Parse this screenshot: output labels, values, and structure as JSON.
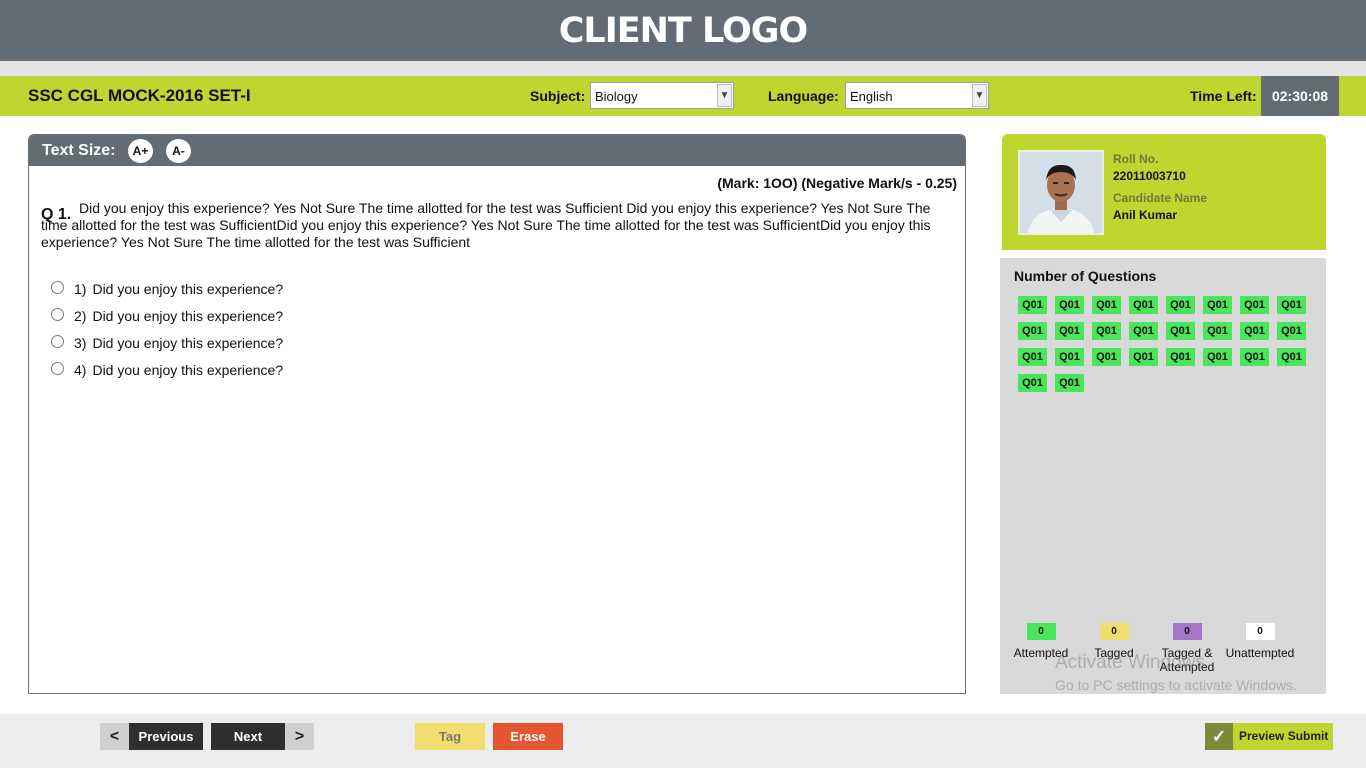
{
  "header": {
    "logo_text": "CLIENT LOGO"
  },
  "exam_bar": {
    "title": "SSC CGL MOCK-2016 SET-I",
    "subject_label": "Subject:",
    "subject_value": "Biology",
    "language_label": "Language:",
    "language_value": "English",
    "time_label": "Time Left:",
    "time_value": "02:30:08"
  },
  "question_panel": {
    "text_size_label": "Text Size:",
    "increase_label": "A+",
    "decrease_label": "A-",
    "marks": "(Mark: 1OO) (Negative Mark/s - 0.25)",
    "question_number": "Q 1.",
    "question_text": "Did you enjoy this experience? Yes Not Sure The time allotted for the test was Sufficient Did you enjoy this experience? Yes Not Sure The time allotted for the test was SufficientDid you enjoy this experience? Yes Not Sure The time allotted for the test was SufficientDid you enjoy this experience? Yes Not Sure The time allotted for the test was Sufficient",
    "options": [
      {
        "num": "1)",
        "text": "Did you enjoy this experience?"
      },
      {
        "num": "2)",
        "text": "Did you enjoy this experience?"
      },
      {
        "num": "3)",
        "text": "Did you enjoy this experience?"
      },
      {
        "num": "4)",
        "text": "Did you enjoy this experience?"
      }
    ]
  },
  "candidate": {
    "roll_label": "Roll No.",
    "roll_value": "22011003710",
    "name_label": "Candidate Name",
    "name_value": "Anil Kumar"
  },
  "question_grid": {
    "title": "Number of Questions",
    "buttons": [
      "Q01",
      "Q01",
      "Q01",
      "Q01",
      "Q01",
      "Q01",
      "Q01",
      "Q01",
      "Q01",
      "Q01",
      "Q01",
      "Q01",
      "Q01",
      "Q01",
      "Q01",
      "Q01",
      "Q01",
      "Q01",
      "Q01",
      "Q01",
      "Q01",
      "Q01",
      "Q01",
      "Q01",
      "Q01",
      "Q01"
    ],
    "button_color": "#4be55b"
  },
  "legend": [
    {
      "count": "0",
      "label_line1": "Attempted",
      "label_line2": "",
      "color": "#4be55b"
    },
    {
      "count": "0",
      "label_line1": "Tagged",
      "label_line2": "",
      "color": "#f2de6f"
    },
    {
      "count": "0",
      "label_line1": "Tagged &",
      "label_line2": "Attempted",
      "color": "#a476c8"
    },
    {
      "count": "0",
      "label_line1": "Unattempted",
      "label_line2": "",
      "color": "#ffffff"
    }
  ],
  "watermark": {
    "line1": "Activate Windows",
    "line2": "Go to PC settings to activate Windows."
  },
  "footer": {
    "prev_chevron": "<",
    "previous_label": "Previous",
    "next_label": "Next",
    "next_chevron": ">",
    "tag_label": "Tag",
    "erase_label": "Erase",
    "preview_check": "✓",
    "preview_label": "Preview Submit"
  }
}
